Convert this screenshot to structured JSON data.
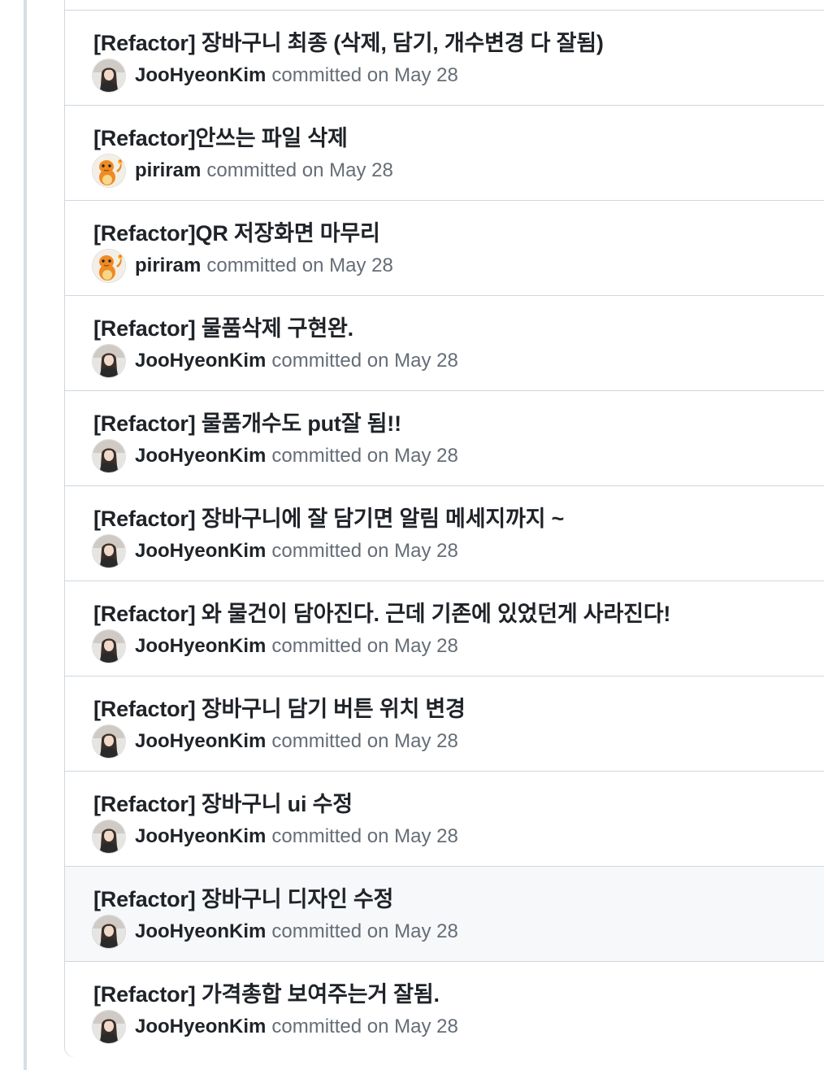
{
  "commits": [
    {
      "message": "[Refactor] 장바구니 최종 (삭제, 담기, 개수변경 다 잘됨)",
      "author": "JooHyeonKim",
      "avatar_icon": "person-photo-icon",
      "verb": "committed",
      "date": "on May 28"
    },
    {
      "message": "[Refactor]안쓰는 파일 삭제",
      "author": "piriram",
      "avatar_icon": "orange-dragon-icon",
      "verb": "committed",
      "date": "on May 28"
    },
    {
      "message": "[Refactor]QR 저장화면 마무리",
      "author": "piriram",
      "avatar_icon": "orange-dragon-icon",
      "verb": "committed",
      "date": "on May 28"
    },
    {
      "message": "[Refactor] 물품삭제 구현완.",
      "author": "JooHyeonKim",
      "avatar_icon": "person-photo-icon",
      "verb": "committed",
      "date": "on May 28"
    },
    {
      "message": "[Refactor] 물품개수도 put잘 됨!!",
      "author": "JooHyeonKim",
      "avatar_icon": "person-photo-icon",
      "verb": "committed",
      "date": "on May 28"
    },
    {
      "message": "[Refactor] 장바구니에 잘 담기면 알림 메세지까지 ~",
      "author": "JooHyeonKim",
      "avatar_icon": "person-photo-icon",
      "verb": "committed",
      "date": "on May 28"
    },
    {
      "message": "[Refactor] 와 물건이 담아진다. 근데 기존에 있었던게 사라진다!",
      "author": "JooHyeonKim",
      "avatar_icon": "person-photo-icon",
      "verb": "committed",
      "date": "on May 28"
    },
    {
      "message": "[Refactor] 장바구니 담기 버튼 위치 변경",
      "author": "JooHyeonKim",
      "avatar_icon": "person-photo-icon",
      "verb": "committed",
      "date": "on May 28"
    },
    {
      "message": "[Refactor] 장바구니 ui 수정",
      "author": "JooHyeonKim",
      "avatar_icon": "person-photo-icon",
      "verb": "committed",
      "date": "on May 28"
    },
    {
      "message": "[Refactor] 장바구니 디자인 수정",
      "author": "JooHyeonKim",
      "avatar_icon": "person-photo-icon",
      "verb": "committed",
      "date": "on May 28",
      "hovered": true
    },
    {
      "message": "[Refactor] 가격총합 보여주는거 잘됨.",
      "author": "JooHyeonKim",
      "avatar_icon": "person-photo-icon",
      "verb": "committed",
      "date": "on May 28"
    }
  ],
  "colors": {
    "title_text": "#1f2328",
    "muted_text": "#656d76",
    "border": "#d0d7de",
    "timeline": "#d8dee4",
    "hover_background": "#f6f8fa"
  }
}
